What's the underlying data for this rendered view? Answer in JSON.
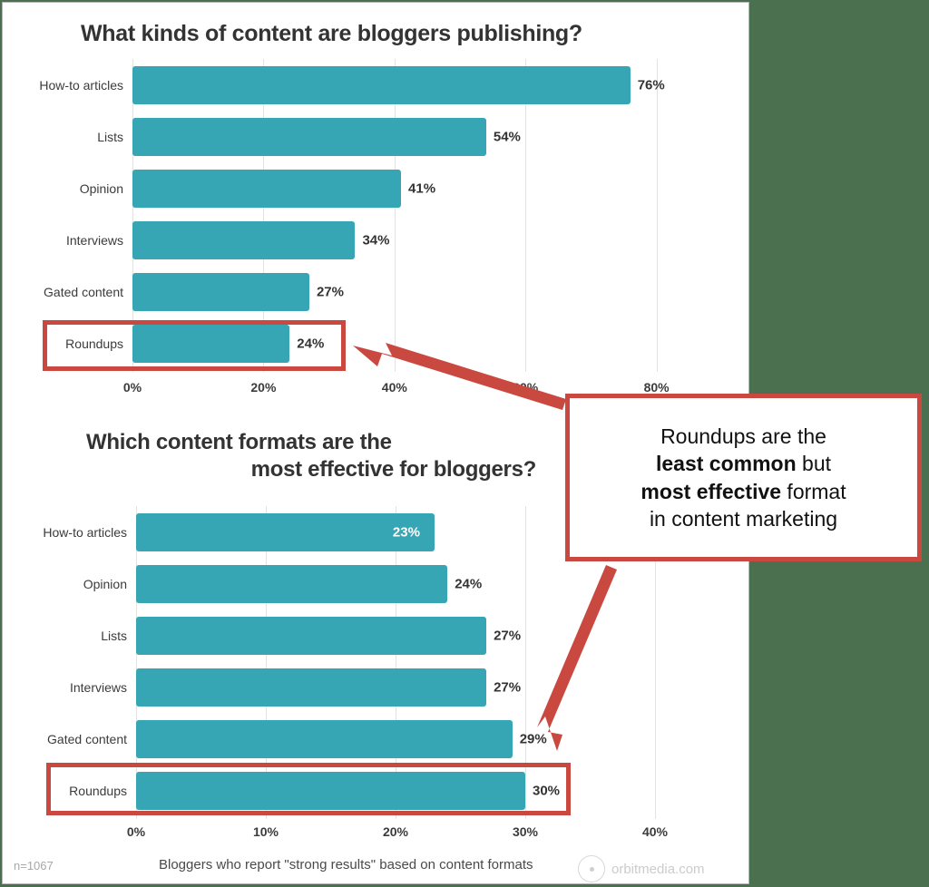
{
  "page": {
    "background_color": "#4a7050",
    "card_background": "#ffffff",
    "accent_teal": "#37a6b4",
    "accent_red": "#c9483f"
  },
  "callout": {
    "line1": "Roundups are the ",
    "line2_bold": "least common",
    "line2_rest": " but",
    "line3_bold": "most effective",
    "line3_rest": " format",
    "line4": "in content marketing"
  },
  "footer": {
    "sample_size": "n=1067",
    "caption": "Bloggers who report \"strong results\" based on content formats",
    "logo_text": "orbitmedia.com"
  },
  "chart_data": [
    {
      "type": "bar",
      "orientation": "horizontal",
      "title": "What kinds of content are bloggers publishing?",
      "xlabel": "",
      "ylabel": "",
      "xlim": [
        0,
        84
      ],
      "ticks": [
        "0%",
        "20%",
        "40%",
        "60%",
        "80%"
      ],
      "tick_values": [
        0,
        20,
        40,
        60,
        80
      ],
      "grid": true,
      "legend": "none",
      "bar_color": "#37a6b4",
      "categories": [
        "How-to articles",
        "Lists",
        "Opinion",
        "Interviews",
        "Gated content",
        "Roundups"
      ],
      "values": [
        76,
        54,
        41,
        34,
        27,
        24
      ],
      "labels": [
        "76%",
        "54%",
        "41%",
        "34%",
        "27%",
        "24%"
      ],
      "label_position": [
        "outside",
        "outside",
        "outside",
        "outside",
        "outside",
        "outside"
      ],
      "highlighted_category": "Roundups"
    },
    {
      "type": "bar",
      "orientation": "horizontal",
      "title_line1": "Which content formats are the",
      "title_line2": "most effective for bloggers?",
      "xlabel": "",
      "ylabel": "",
      "xlim": [
        0,
        42
      ],
      "ticks": [
        "0%",
        "10%",
        "20%",
        "30%",
        "40%"
      ],
      "tick_values": [
        0,
        10,
        20,
        30,
        40
      ],
      "grid": true,
      "legend": "none",
      "bar_color": "#37a6b4",
      "categories": [
        "How-to articles",
        "Opinion",
        "Lists",
        "Interviews",
        "Gated content",
        "Roundups"
      ],
      "values": [
        23,
        24,
        27,
        27,
        29,
        30
      ],
      "labels": [
        "23%",
        "24%",
        "27%",
        "27%",
        "29%",
        "30%"
      ],
      "label_position": [
        "inside",
        "outside",
        "outside",
        "outside",
        "outside",
        "outside"
      ],
      "highlighted_category": "Roundups"
    }
  ]
}
